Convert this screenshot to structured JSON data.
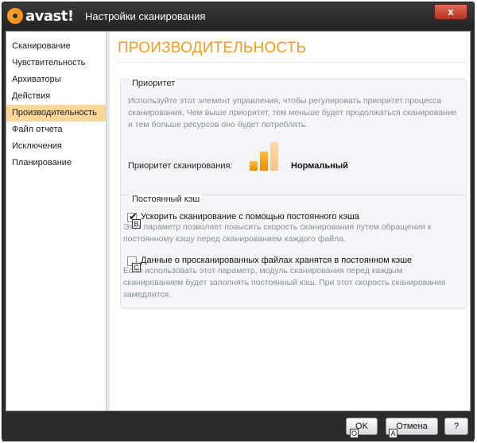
{
  "window": {
    "logo_text": "avast!",
    "title": "Настройки сканирования",
    "close_label": "x"
  },
  "sidebar": {
    "items": [
      {
        "label": "Сканирование"
      },
      {
        "label": "Чувствительность"
      },
      {
        "label": "Архиваторы"
      },
      {
        "label": "Действия"
      },
      {
        "label": "Производительность",
        "selected": true
      },
      {
        "label": "Файл отчета"
      },
      {
        "label": "Исключения"
      },
      {
        "label": "Планирование"
      }
    ]
  },
  "main": {
    "title": "ПРОИЗВОДИТЕЛЬНОСТЬ",
    "priority_group": {
      "label": "Приоритет",
      "description": "Используйте этот элемент управления, чтобы регулировать приоритет процесса сканирования. Чем выше приоритет, тем меньше будет продолжаться сканирование и тем больше ресурсов оно будет потреблять.",
      "scan_priority_label": "Приоритет сканирования:",
      "scan_priority_value": "Нормальный",
      "priority_level": 2,
      "priority_levels_total": 3
    },
    "cache_group": {
      "label": "Постоянный кэш",
      "option1": {
        "label": "Ускорить сканирование с помощью постоянного кэша",
        "checked": true,
        "hint": "B",
        "description": "Этот параметр позволяет повысить скорость сканирования путем обращения к постоянному кэшу перед сканированием каждого файла."
      },
      "option2": {
        "label": "Данные о просканированных файлах хранятся в постоянном кэше",
        "checked": false,
        "hint": "C",
        "description": "Если использовать этот параметр, модуль сканирования перед каждым сканированием будет заполнять постоянный кэш. При этот скорость сканирования замедлится."
      }
    }
  },
  "footer": {
    "ok_label": "OK",
    "ok_hint": "O",
    "cancel_label": "Отмена",
    "cancel_hint": "A",
    "help_label": "?"
  },
  "colors": {
    "accent": "#f59a1c",
    "selected_bg": "#fcd69a",
    "chrome": "#2b2b2b"
  }
}
